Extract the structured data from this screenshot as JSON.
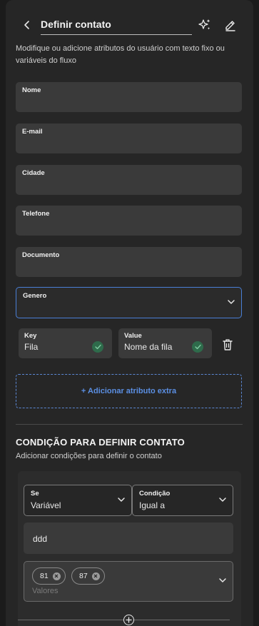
{
  "header": {
    "title": "Definir contato"
  },
  "description": "Modifique ou adicione atributos do usuário com texto fixo ou variáveis do fluxo",
  "fields": [
    {
      "label": "Nome"
    },
    {
      "label": "E-mail"
    },
    {
      "label": "Cidade"
    },
    {
      "label": "Telefone"
    },
    {
      "label": "Documento"
    }
  ],
  "genero": {
    "label": "Genero"
  },
  "extra_attribute": {
    "key_label": "Key",
    "key_value": "Fila",
    "value_label": "Value",
    "value_value": "Nome da fila"
  },
  "add_extra_label": "+ Adicionar atributo extra",
  "conditions": {
    "title": "CONDIÇÃO PARA DEFINIR CONTATO",
    "description": "Adicionar condições para definir o contato",
    "se": {
      "label": "Se",
      "value": "Variável"
    },
    "condicao": {
      "label": "Condição",
      "value": "Igual a"
    },
    "variable_value": "ddd",
    "chips": [
      "81",
      "87"
    ],
    "values_placeholder": "Valores"
  },
  "colors": {
    "accent": "#5b8fe3",
    "success": "#2e6b4b",
    "panel": "#262626",
    "field": "#3a3a3a"
  }
}
